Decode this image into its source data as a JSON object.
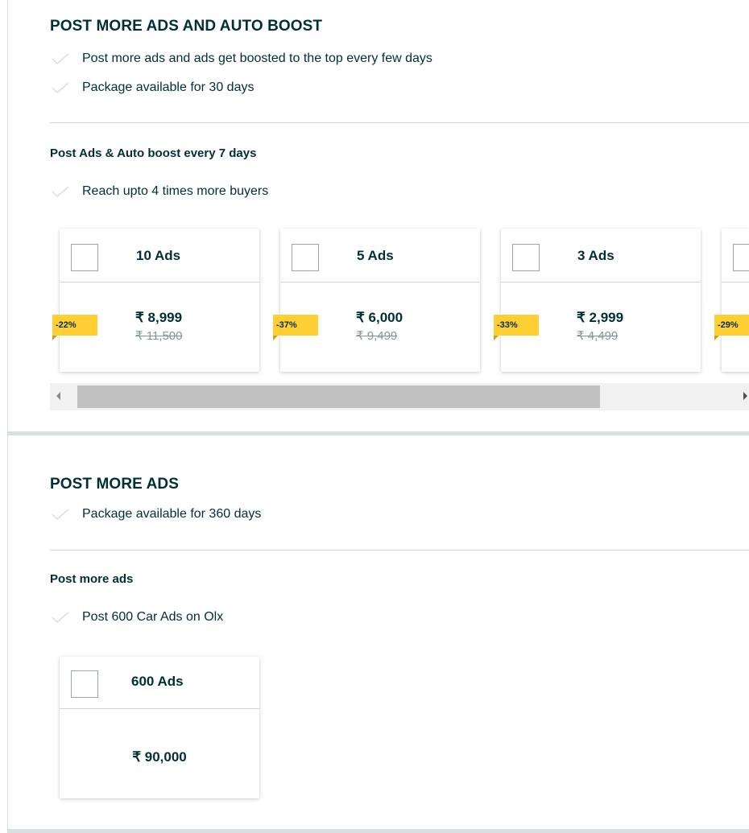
{
  "auto_boost_section": {
    "heading": "POST MORE ADS AND AUTO BOOST",
    "features": [
      "Post more ads and ads get boosted to the top every few days",
      "Package available for 30 days"
    ],
    "subheading": "Post Ads & Auto boost every 7 days",
    "sub_features": [
      "Reach upto 4 times more buyers"
    ],
    "packages": [
      {
        "title": "10 Ads",
        "price": "₹ 8,999",
        "old_price": "₹ 11,500",
        "discount": "-22%"
      },
      {
        "title": "5 Ads",
        "price": "₹ 6,000",
        "old_price": "₹ 9,499",
        "discount": "-37%"
      },
      {
        "title": "3 Ads",
        "price": "₹ 2,999",
        "old_price": "₹ 4,499",
        "discount": "-33%"
      },
      {
        "title": "",
        "price": "",
        "old_price": "",
        "discount": "-29%"
      }
    ]
  },
  "post_more_section": {
    "heading": "POST MORE ADS",
    "features": [
      "Package available for 360 days"
    ],
    "subheading": "Post more ads",
    "sub_features": [
      "Post 600 Car Ads on Olx"
    ],
    "packages": [
      {
        "title": "600 Ads",
        "price": "₹ 90,000"
      }
    ]
  },
  "colors": {
    "text": "#002f34",
    "badge": "#ffce32",
    "divider": "#d8dfe0",
    "check": "#d8dfe0"
  }
}
